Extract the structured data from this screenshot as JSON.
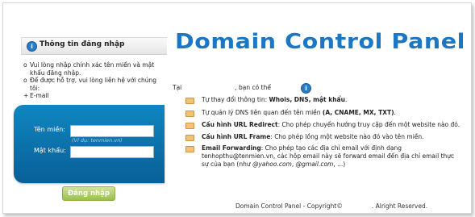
{
  "login_panel": {
    "title": "Thông tin đăng nhập",
    "notes": [
      {
        "bullet": "o",
        "text": "Vui lòng nhập chính xác tên miền và mật khẩu đăng nhập."
      },
      {
        "bullet": "o",
        "text": "Để được hỗ trợ, vui lòng liên hệ với chúng tôi:"
      },
      {
        "bullet": "+",
        "text": "E-mail"
      }
    ],
    "domain_label": "Tên miền:",
    "domain_value": "",
    "domain_hint": "(Ví dụ: tenmien.vn)",
    "password_label": "Mật khẩu:",
    "password_value": "",
    "login_button": "Đăng nhập"
  },
  "logo": {
    "text": "Domain Control Panel"
  },
  "intro": {
    "prefix": "Tại",
    "suffix": ", bạn có thể"
  },
  "features": [
    {
      "text": "Tự thay đổi thông tin: ",
      "bold": "Whois, DNS, mật khẩu",
      "after": "."
    },
    {
      "text": "Tự quản lý DNS liên quan đến tên miền ",
      "bold": "(A, CNAME, MX, TXT)",
      "after": "."
    },
    {
      "bold": "Cấu hình URL Redirect",
      "text": ": Cho phép chuyển hướng truy cập đến một website nào đó."
    },
    {
      "bold": "Cấu hình URL Frame",
      "text": ": Cho phép lồng một website nào đó vào tên miền."
    },
    {
      "bold": "Email Forwarding",
      "text": ": Cho phép tạo các địa chỉ email với định dạng tenhopthu@tenmien.vn, các hộp email này sẽ forward email đến địa chỉ email thực sự của bạn (như ",
      "italic1": "@yahoo.com",
      "mid": ", ",
      "italic2": "@gmail.com",
      "end": ", ...)"
    }
  ],
  "footer": {
    "text": "Domain Control Panel - Copyright©",
    "suffix": ". Alright Reserved."
  },
  "colors": {
    "brand_blue": "#1b76c4",
    "login_box": "#0a70ad",
    "button_green": "#a9c95c",
    "bullet_orange": "#f2c276"
  },
  "icons": {
    "info": "info-icon",
    "bullet": "bullet-icon"
  }
}
